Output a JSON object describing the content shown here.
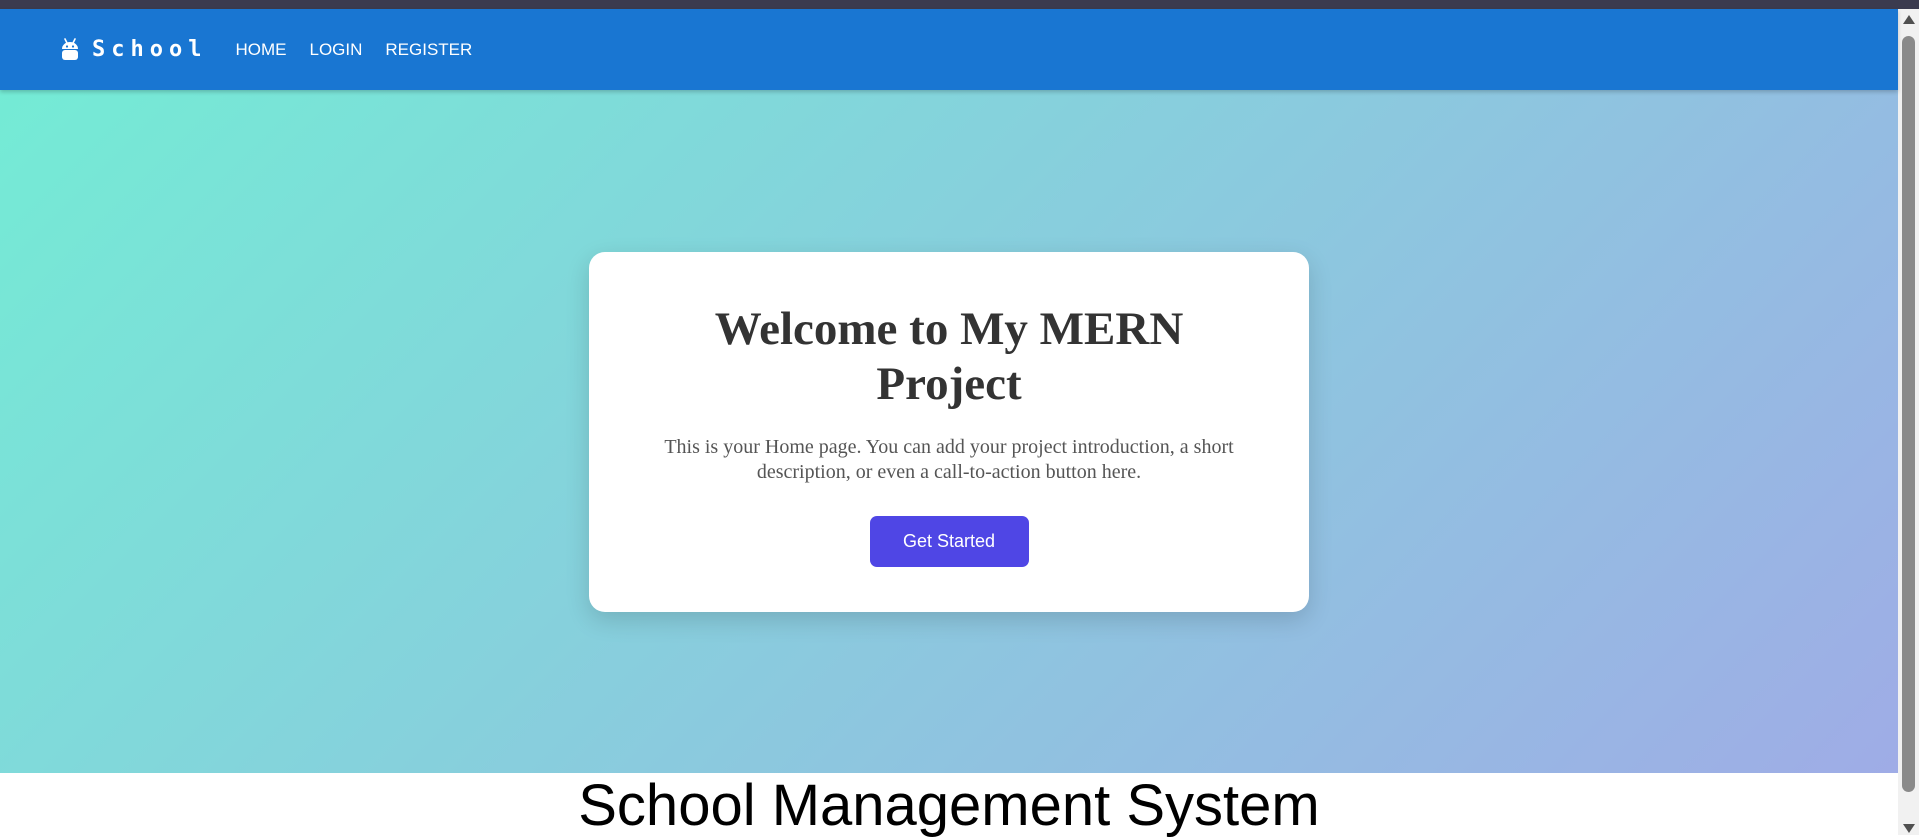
{
  "appbar": {
    "brand_icon": "android-icon",
    "brand": "School",
    "nav": [
      {
        "label": "HOME"
      },
      {
        "label": "LOGIN"
      },
      {
        "label": "REGISTER"
      }
    ]
  },
  "hero": {
    "title": "Welcome to My MERN Project",
    "description": "This is your Home page. You can add your project introduction, a short description, or even a call-to-action button here.",
    "cta_label": "Get Started"
  },
  "footer": {
    "title": "School Management System"
  },
  "colors": {
    "appbar": "#1976d2",
    "gradient_start": "#74ebd5",
    "gradient_end": "#9face6",
    "button": "#4f46e5",
    "title_text": "#333333"
  }
}
